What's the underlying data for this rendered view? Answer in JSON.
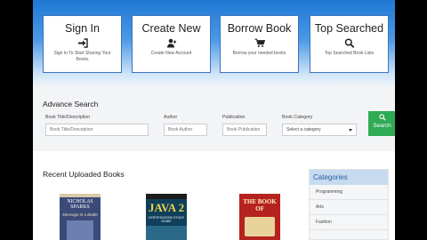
{
  "cards": [
    {
      "title": "Sign In",
      "icon": "sign-in-icon",
      "desc": "Sign In To Start Sharing Your Books"
    },
    {
      "title": "Create New",
      "icon": "user-plus-icon",
      "desc": "Create New Account"
    },
    {
      "title": "Borrow Book",
      "icon": "cart-icon",
      "desc": "Borrow your needed books"
    },
    {
      "title": "Top Searched",
      "icon": "search-icon",
      "desc": "Top Searched Book Lists"
    }
  ],
  "search": {
    "title": "Advance Search",
    "fields": [
      {
        "label": "Book Title/Description",
        "placeholder": "Book Title/Description"
      },
      {
        "label": "Author",
        "placeholder": "Book Author"
      },
      {
        "label": "Publication",
        "placeholder": "Book Publication"
      }
    ],
    "category": {
      "label": "Book Category",
      "selected": "Select a category"
    },
    "button_label": "Search"
  },
  "recent": {
    "title": "Recent Uploaded Books",
    "books": [
      {
        "author": "NICHOLAS SPARKS",
        "title": "Message in a Bottle",
        "color": "#3b4a78"
      },
      {
        "title": "JAVA 2",
        "subtitle": "CERTIFICATION STUDY GUIDE",
        "color": "#0f3f5a"
      },
      {
        "title": "THE BOOK OF",
        "color": "#b5221f"
      }
    ]
  },
  "categories": {
    "title": "Categories",
    "items": [
      "Programming",
      "Arts",
      "Fashion"
    ]
  }
}
